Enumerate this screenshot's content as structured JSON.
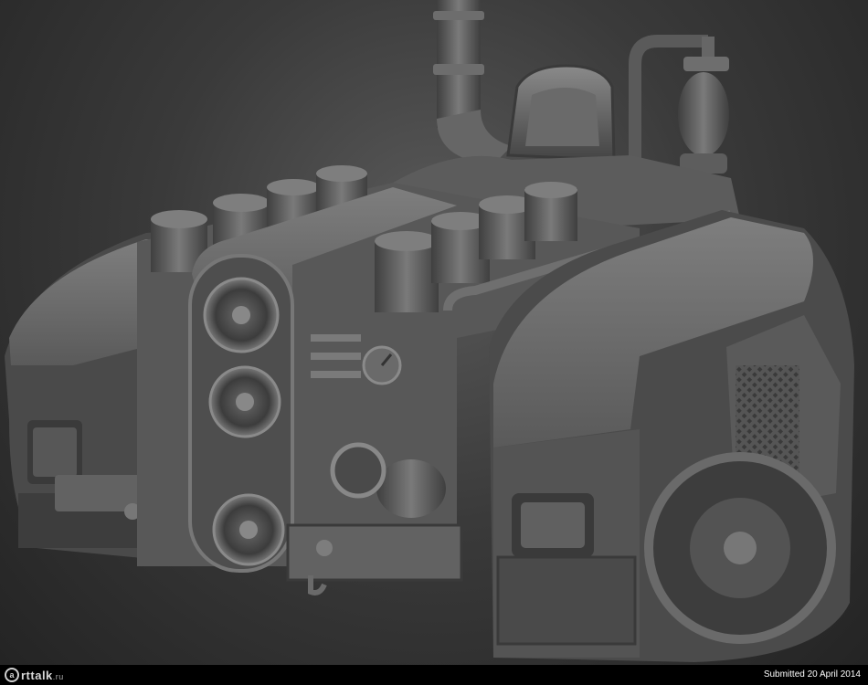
{
  "footer": {
    "logo_mark": "a",
    "logo_text": "rttalk",
    "logo_tld": ".ru",
    "submitted": "Submitted 20 April 2014"
  },
  "scene": {
    "subject": "steampunk tracked vehicle sculpt",
    "palette": {
      "background_light": "#5a5a5a",
      "background_dark": "#232323",
      "clay_light": "#8a8a8a",
      "clay_mid": "#5e5e5e",
      "clay_dark": "#2c2c2c",
      "footer_bar": "#000000"
    }
  }
}
